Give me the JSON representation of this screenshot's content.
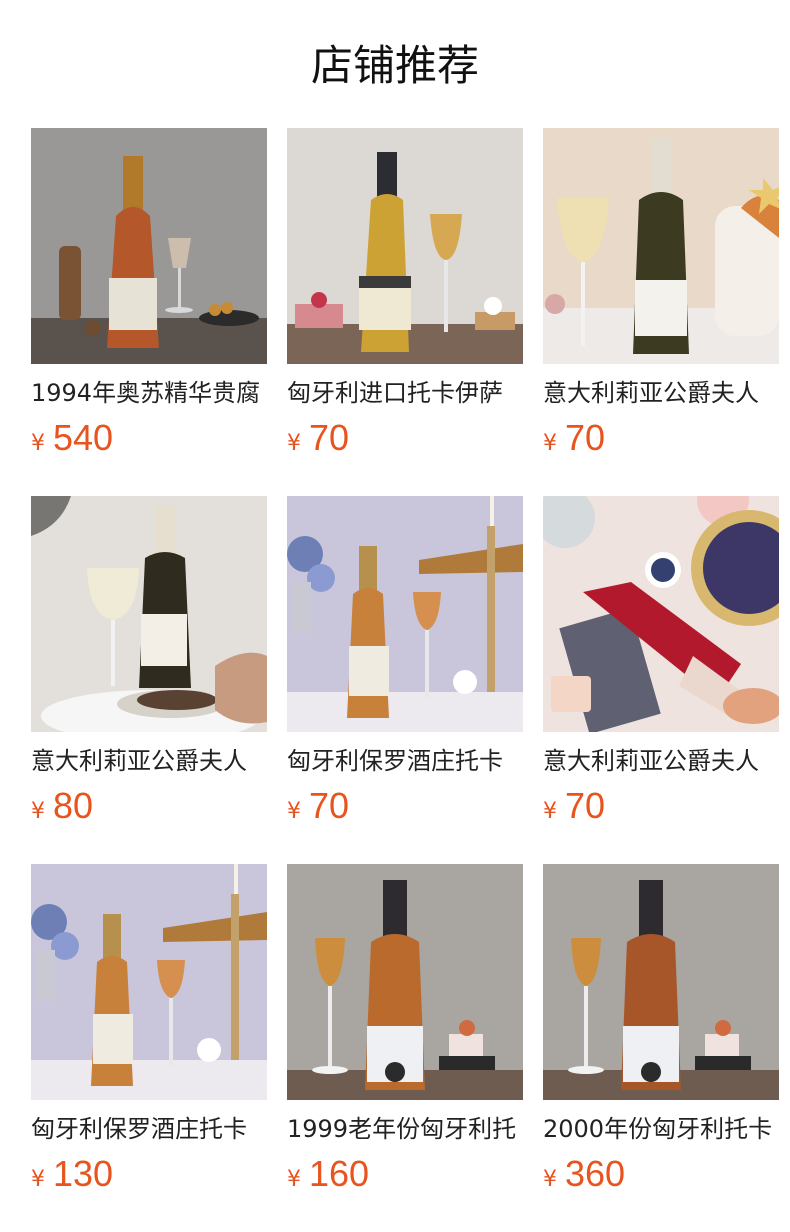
{
  "header": {
    "title": "店铺推荐"
  },
  "currency_symbol": "¥",
  "accent_color": "#e8541e",
  "products": [
    {
      "name": "1994年奥苏精华贵腐",
      "price": "540",
      "image": "amber-tokaji-bottle-with-walnuts"
    },
    {
      "name": "匈牙利进口托卡伊萨",
      "price": "70",
      "image": "golden-tokaji-bottle-with-desserts"
    },
    {
      "name": "意大利莉亚公爵夫人",
      "price": "70",
      "image": "asti-sparkling-bottle-with-cake"
    },
    {
      "name": "意大利莉亚公爵夫人",
      "price": "80",
      "image": "moscato-bottle-with-glass"
    },
    {
      "name": "匈牙利保罗酒庄托卡",
      "price": "70",
      "image": "tokaji-pouring-into-glass"
    },
    {
      "name": "意大利莉亚公爵夫人",
      "price": "70",
      "image": "red-sparkling-bottle-with-berries"
    },
    {
      "name": "匈牙利保罗酒庄托卡",
      "price": "130",
      "image": "tokaji-pouring-into-glass"
    },
    {
      "name": "1999老年份匈牙利托",
      "price": "160",
      "image": "aged-tokaji-bottle-with-glass"
    },
    {
      "name": "2000年份匈牙利托卡",
      "price": "360",
      "image": "aged-tokaji-bottle-with-glass"
    }
  ]
}
